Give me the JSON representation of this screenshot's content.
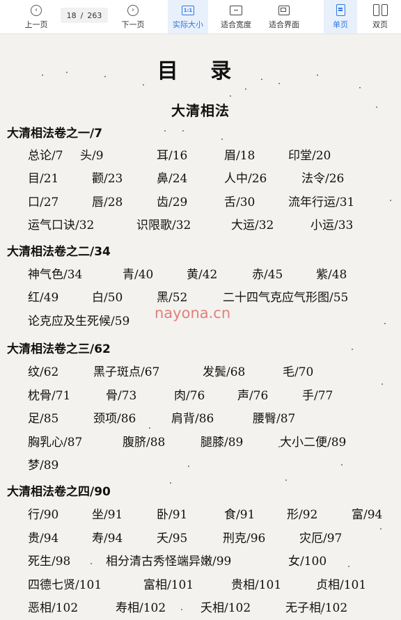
{
  "toolbar": {
    "prev_label": "上一页",
    "next_label": "下一页",
    "current_page": "18",
    "separator": "/",
    "total_pages": "263",
    "actual_size_label": "实际大小",
    "actual_size_icon": "1:1",
    "fit_width_label": "适合宽度",
    "fit_width_icon": "↔",
    "fit_screen_label": "适合界面",
    "single_page_label": "单页",
    "double_page_label": "双页",
    "accent_color": "#2e77e5"
  },
  "document": {
    "toc_title": "目 录",
    "book_title": "大清相法",
    "watermark": "nayona.cn",
    "sections": [
      {
        "title": "大清相法卷之一/7",
        "rows": [
          [
            "总论/7",
            "头/9",
            "耳/16",
            "眉/18",
            "印堂/20"
          ],
          [
            "目/21",
            "颧/23",
            "鼻/24",
            "人中/26",
            "法令/26"
          ],
          [
            "口/27",
            "唇/28",
            "齿/29",
            "舌/30",
            "流年行运/31"
          ],
          [
            "运气口诀/32",
            "识限歌/32",
            "大运/32",
            "小运/33"
          ]
        ]
      },
      {
        "title": "大清相法卷之二/34",
        "rows": [
          [
            "神气色/34",
            "青/40",
            "黄/42",
            "赤/45",
            "紫/48"
          ],
          [
            "红/49",
            "白/50",
            "黑/52",
            "二十四气克应气形图/55"
          ],
          [
            "论克应及生死候/59"
          ]
        ]
      },
      {
        "title": "大清相法卷之三/62",
        "rows": [
          [
            "纹/62",
            "黑子斑点/67",
            "发鬓/68",
            "毛/70"
          ],
          [
            "枕骨/71",
            "骨/73",
            "肉/76",
            "声/76",
            "手/77"
          ],
          [
            "足/85",
            "颈项/86",
            "肩背/86",
            "腰臀/87"
          ],
          [
            "胸乳心/87",
            "腹脐/88",
            "腿膝/89",
            "大小二便/89"
          ],
          [
            "梦/89"
          ]
        ]
      },
      {
        "title": "大清相法卷之四/90",
        "rows": [
          [
            "行/90",
            "坐/91",
            "卧/91",
            "食/91",
            "形/92",
            "富/94"
          ],
          [
            "贵/94",
            "寿/94",
            "夭/95",
            "刑克/96",
            "灾厄/97"
          ],
          [
            "死生/98",
            "相分清古秀怪端异嫩/99",
            "女/100"
          ],
          [
            "四德七贤/101",
            "富相/101",
            "贵相/101",
            "贞相/101"
          ],
          [
            "恶相/102",
            "寿相/102",
            "夭相/102",
            "无子相/102"
          ]
        ]
      }
    ]
  }
}
